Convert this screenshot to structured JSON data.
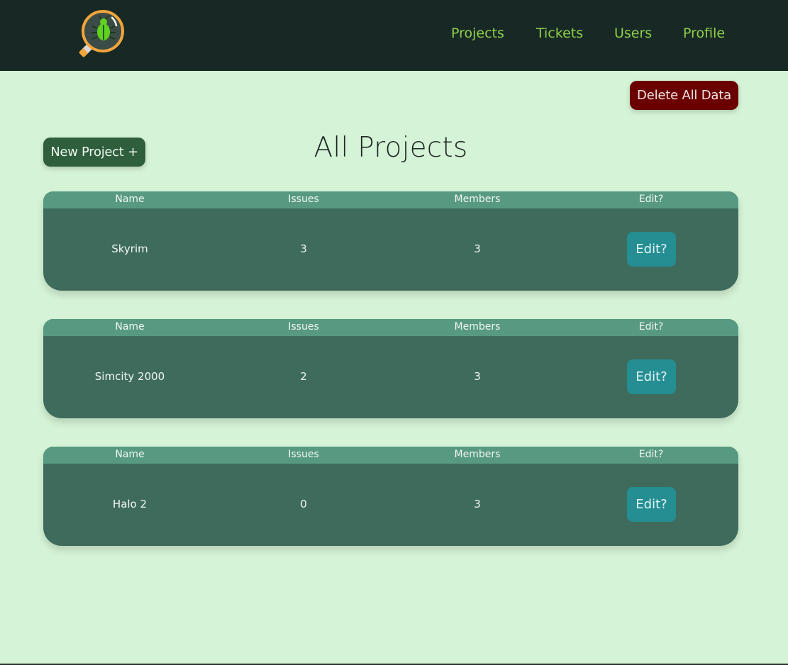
{
  "header": {
    "logo_icon": "bug-magnifier-logo-icon",
    "nav": [
      {
        "label": "Projects"
      },
      {
        "label": "Tickets"
      },
      {
        "label": "Users"
      },
      {
        "label": "Profile"
      }
    ]
  },
  "actions": {
    "delete_all_label": "Delete All Data",
    "new_project_label": "New Project +"
  },
  "page": {
    "title": "All Projects"
  },
  "table": {
    "columns": [
      "Name",
      "Issues",
      "Members",
      "Edit?"
    ],
    "rows": [
      {
        "name": "Skyrim",
        "issues": "3",
        "members": "3",
        "edit_label": "Edit?"
      },
      {
        "name": "Simcity 2000",
        "issues": "2",
        "members": "3",
        "edit_label": "Edit?"
      },
      {
        "name": "Halo 2",
        "issues": "0",
        "members": "3",
        "edit_label": "Edit?"
      }
    ]
  },
  "colors": {
    "header_bg": "#182925",
    "nav_text": "#8fce4a",
    "page_bg": "#d5f3d6",
    "danger": "#6b0000",
    "new_button": "#2e5e3b",
    "card_bg": "#3e6b5c",
    "card_header": "#579a81",
    "edit_button": "#248e93"
  }
}
